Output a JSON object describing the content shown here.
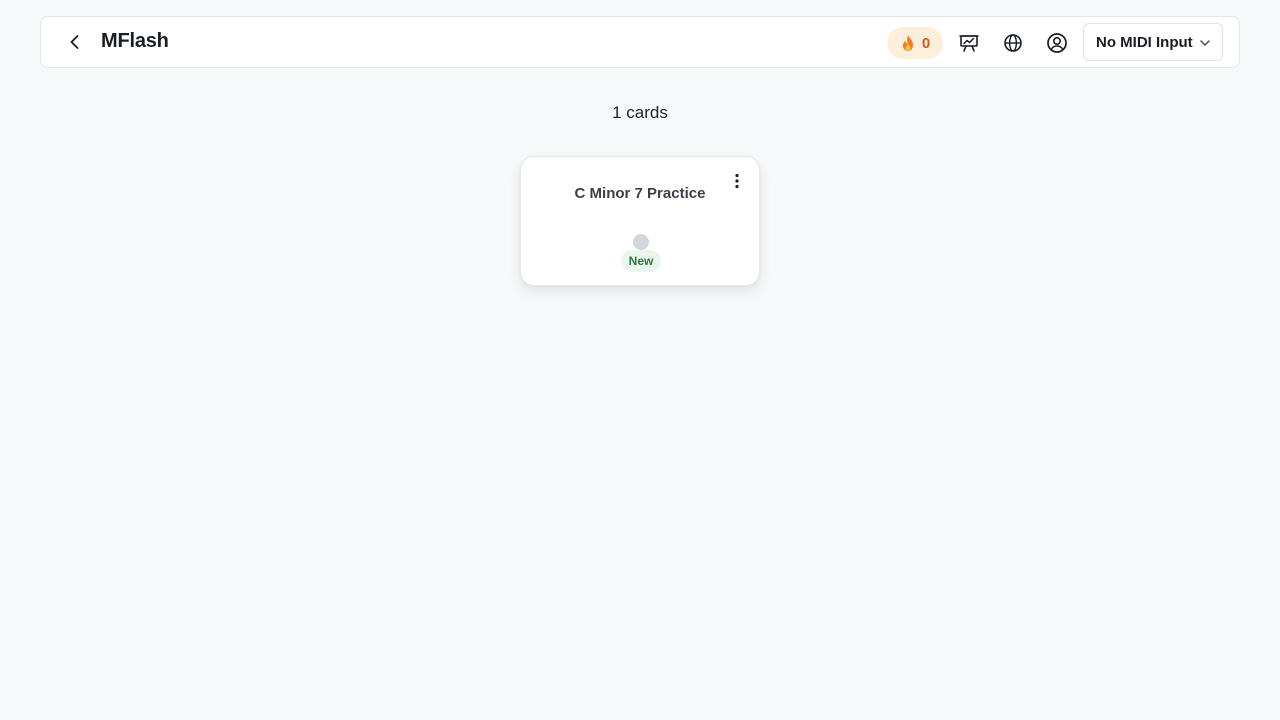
{
  "header": {
    "title": "MFlash",
    "back_icon": "chevron-left-icon",
    "streak": {
      "icon": "fire-icon",
      "count": "0",
      "bg_color": "#fdefdc",
      "text_color": "#d4591a"
    },
    "icons": [
      "presentation-chart-icon",
      "globe-icon",
      "user-circle-icon"
    ],
    "midi": {
      "selected": "No MIDI Input",
      "icon": "chevron-down-icon"
    }
  },
  "main": {
    "card_count_label": "1 cards",
    "cards": [
      {
        "title": "C Minor 7 Practice",
        "status": "New",
        "status_color": "#2b7a3b",
        "menu_icon": "kebab-menu-icon"
      }
    ]
  }
}
